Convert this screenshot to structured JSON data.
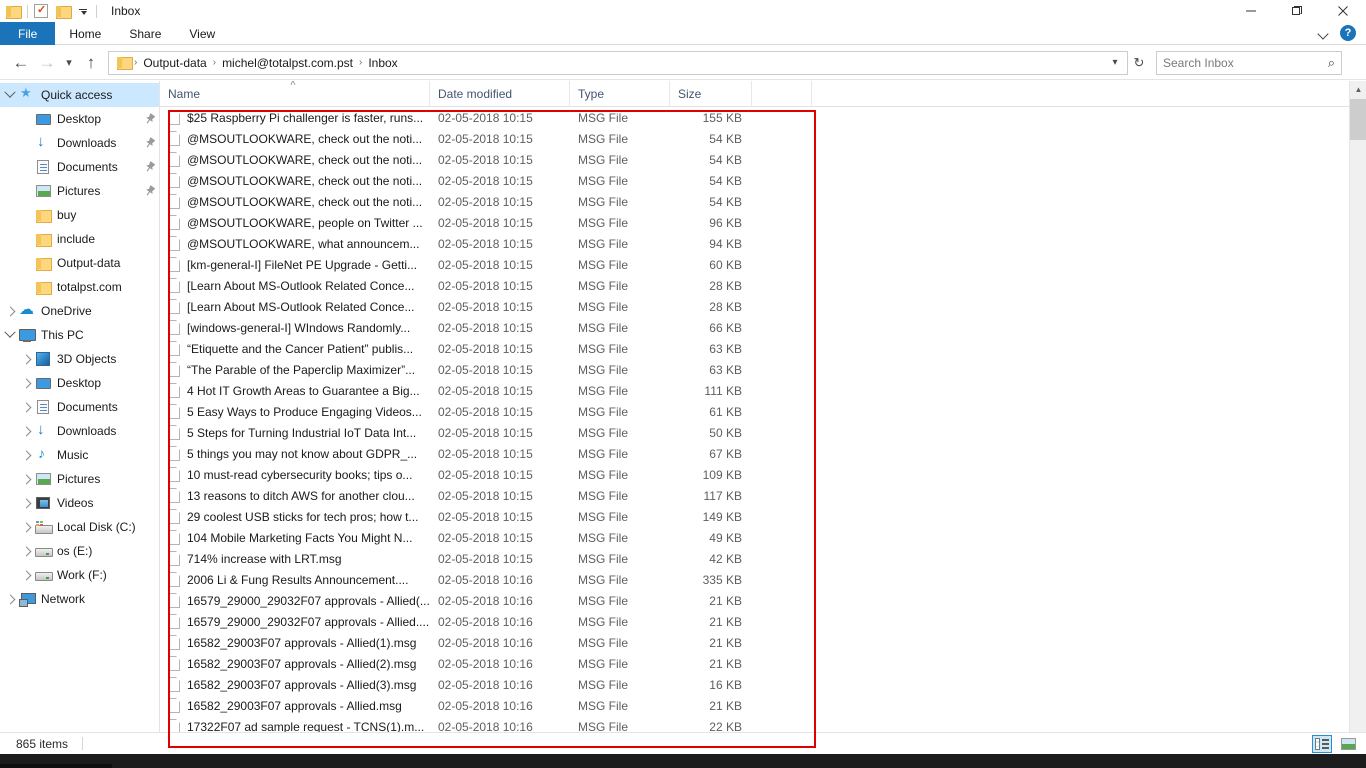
{
  "window": {
    "title": "Inbox",
    "quick_access_icons": [
      "folder-icon",
      "properties-icon",
      "new-folder-icon",
      "customize-dropdown-icon"
    ],
    "controls": {
      "minimize": "minimize-icon",
      "maximize": "maximize-icon",
      "close": "close-icon"
    }
  },
  "ribbon": {
    "tabs": [
      {
        "label": "File",
        "active": true
      },
      {
        "label": "Home",
        "active": false
      },
      {
        "label": "Share",
        "active": false
      },
      {
        "label": "View",
        "active": false
      }
    ],
    "collapse_icon": "chevron-down-icon",
    "help_label": "?"
  },
  "address_bar": {
    "back_icon": "back-arrow-icon",
    "forward_icon": "forward-arrow-icon",
    "recent_icon": "recent-locations-chevron-icon",
    "up_icon": "up-arrow-icon",
    "breadcrumb": [
      "Output-data",
      "michel@totalpst.com.pst",
      "Inbox"
    ],
    "separator": "›",
    "refresh_icon": "refresh-icon",
    "dropdown_icon": "chevron-down-icon"
  },
  "search": {
    "placeholder": "Search Inbox",
    "value": "",
    "icon": "search-icon"
  },
  "sidebar": {
    "items": [
      {
        "label": "Quick access",
        "indent": 0,
        "expander": "open",
        "icon": "quick-access-star-icon",
        "selected": true,
        "pinned": false
      },
      {
        "label": "Desktop",
        "indent": 1,
        "expander": "none",
        "icon": "desktop-icon",
        "selected": false,
        "pinned": true
      },
      {
        "label": "Downloads",
        "indent": 1,
        "expander": "none",
        "icon": "downloads-icon",
        "selected": false,
        "pinned": true
      },
      {
        "label": "Documents",
        "indent": 1,
        "expander": "none",
        "icon": "documents-icon",
        "selected": false,
        "pinned": true
      },
      {
        "label": "Pictures",
        "indent": 1,
        "expander": "none",
        "icon": "pictures-icon",
        "selected": false,
        "pinned": true
      },
      {
        "label": "buy",
        "indent": 1,
        "expander": "none",
        "icon": "folder-icon",
        "selected": false,
        "pinned": false
      },
      {
        "label": "include",
        "indent": 1,
        "expander": "none",
        "icon": "folder-icon",
        "selected": false,
        "pinned": false
      },
      {
        "label": "Output-data",
        "indent": 1,
        "expander": "none",
        "icon": "folder-icon",
        "selected": false,
        "pinned": false
      },
      {
        "label": "totalpst.com",
        "indent": 1,
        "expander": "none",
        "icon": "folder-icon",
        "selected": false,
        "pinned": false
      },
      {
        "label": "OneDrive",
        "indent": 0,
        "expander": "closed",
        "icon": "onedrive-cloud-icon",
        "selected": false,
        "pinned": false
      },
      {
        "label": "This PC",
        "indent": 0,
        "expander": "open",
        "icon": "this-pc-icon",
        "selected": false,
        "pinned": false
      },
      {
        "label": "3D Objects",
        "indent": 1,
        "expander": "closed",
        "icon": "3d-objects-icon",
        "selected": false,
        "pinned": false
      },
      {
        "label": "Desktop",
        "indent": 1,
        "expander": "closed",
        "icon": "desktop-icon",
        "selected": false,
        "pinned": false
      },
      {
        "label": "Documents",
        "indent": 1,
        "expander": "closed",
        "icon": "documents-icon",
        "selected": false,
        "pinned": false
      },
      {
        "label": "Downloads",
        "indent": 1,
        "expander": "closed",
        "icon": "downloads-icon",
        "selected": false,
        "pinned": false
      },
      {
        "label": "Music",
        "indent": 1,
        "expander": "closed",
        "icon": "music-icon",
        "selected": false,
        "pinned": false
      },
      {
        "label": "Pictures",
        "indent": 1,
        "expander": "closed",
        "icon": "pictures-icon",
        "selected": false,
        "pinned": false
      },
      {
        "label": "Videos",
        "indent": 1,
        "expander": "closed",
        "icon": "videos-icon",
        "selected": false,
        "pinned": false
      },
      {
        "label": "Local Disk (C:)",
        "indent": 1,
        "expander": "closed",
        "icon": "local-disk-icon",
        "selected": false,
        "pinned": false
      },
      {
        "label": "os (E:)",
        "indent": 1,
        "expander": "closed",
        "icon": "drive-icon",
        "selected": false,
        "pinned": false
      },
      {
        "label": "Work (F:)",
        "indent": 1,
        "expander": "closed",
        "icon": "drive-icon",
        "selected": false,
        "pinned": false
      },
      {
        "label": "Network",
        "indent": 0,
        "expander": "closed",
        "icon": "network-icon",
        "selected": false,
        "pinned": false
      }
    ]
  },
  "file_list": {
    "columns": [
      {
        "label": "Name",
        "sorted": "asc"
      },
      {
        "label": "Date modified",
        "sorted": ""
      },
      {
        "label": "Type",
        "sorted": ""
      },
      {
        "label": "Size",
        "sorted": ""
      }
    ],
    "sort_indicator": "˄",
    "rows": [
      {
        "name": "$25 Raspberry Pi challenger is faster, runs...",
        "date": "02-05-2018 10:15",
        "type": "MSG File",
        "size": "155 KB"
      },
      {
        "name": "@MSOUTLOOKWARE, check out the noti...",
        "date": "02-05-2018 10:15",
        "type": "MSG File",
        "size": "54 KB"
      },
      {
        "name": "@MSOUTLOOKWARE, check out the noti...",
        "date": "02-05-2018 10:15",
        "type": "MSG File",
        "size": "54 KB"
      },
      {
        "name": "@MSOUTLOOKWARE, check out the noti...",
        "date": "02-05-2018 10:15",
        "type": "MSG File",
        "size": "54 KB"
      },
      {
        "name": "@MSOUTLOOKWARE, check out the noti...",
        "date": "02-05-2018 10:15",
        "type": "MSG File",
        "size": "54 KB"
      },
      {
        "name": "@MSOUTLOOKWARE, people on Twitter ...",
        "date": "02-05-2018 10:15",
        "type": "MSG File",
        "size": "96 KB"
      },
      {
        "name": "@MSOUTLOOKWARE, what announcem...",
        "date": "02-05-2018 10:15",
        "type": "MSG File",
        "size": "94 KB"
      },
      {
        "name": "[km-general-I] FileNet PE Upgrade - Getti...",
        "date": "02-05-2018 10:15",
        "type": "MSG File",
        "size": "60 KB"
      },
      {
        "name": "[Learn About MS-Outlook Related Conce...",
        "date": "02-05-2018 10:15",
        "type": "MSG File",
        "size": "28 KB"
      },
      {
        "name": "[Learn About MS-Outlook Related Conce...",
        "date": "02-05-2018 10:15",
        "type": "MSG File",
        "size": "28 KB"
      },
      {
        "name": "[windows-general-I] WIndows Randomly...",
        "date": "02-05-2018 10:15",
        "type": "MSG File",
        "size": "66 KB"
      },
      {
        "name": "“Etiquette and the Cancer Patient” publis...",
        "date": "02-05-2018 10:15",
        "type": "MSG File",
        "size": "63 KB"
      },
      {
        "name": "“The Parable of the Paperclip Maximizer”...",
        "date": "02-05-2018 10:15",
        "type": "MSG File",
        "size": "63 KB"
      },
      {
        "name": "4 Hot IT Growth Areas to Guarantee a Big...",
        "date": "02-05-2018 10:15",
        "type": "MSG File",
        "size": "111 KB"
      },
      {
        "name": "5 Easy Ways to Produce Engaging Videos...",
        "date": "02-05-2018 10:15",
        "type": "MSG File",
        "size": "61 KB"
      },
      {
        "name": "5 Steps for Turning Industrial IoT Data Int...",
        "date": "02-05-2018 10:15",
        "type": "MSG File",
        "size": "50 KB"
      },
      {
        "name": "5 things you may not know about GDPR_...",
        "date": "02-05-2018 10:15",
        "type": "MSG File",
        "size": "67 KB"
      },
      {
        "name": "10 must-read cybersecurity books; tips o...",
        "date": "02-05-2018 10:15",
        "type": "MSG File",
        "size": "109 KB"
      },
      {
        "name": "13 reasons to ditch AWS for another clou...",
        "date": "02-05-2018 10:15",
        "type": "MSG File",
        "size": "117 KB"
      },
      {
        "name": "29 coolest USB sticks for tech pros; how t...",
        "date": "02-05-2018 10:15",
        "type": "MSG File",
        "size": "149 KB"
      },
      {
        "name": "104 Mobile Marketing Facts You Might N...",
        "date": "02-05-2018 10:15",
        "type": "MSG File",
        "size": "49 KB"
      },
      {
        "name": "714% increase with LRT.msg",
        "date": "02-05-2018 10:15",
        "type": "MSG File",
        "size": "42 KB"
      },
      {
        "name": "2006 Li & Fung Results Announcement....",
        "date": "02-05-2018 10:16",
        "type": "MSG File",
        "size": "335 KB"
      },
      {
        "name": "16579_29000_29032F07 approvals - Allied(...",
        "date": "02-05-2018 10:16",
        "type": "MSG File",
        "size": "21 KB"
      },
      {
        "name": "16579_29000_29032F07 approvals - Allied....",
        "date": "02-05-2018 10:16",
        "type": "MSG File",
        "size": "21 KB"
      },
      {
        "name": "16582_29003F07 approvals - Allied(1).msg",
        "date": "02-05-2018 10:16",
        "type": "MSG File",
        "size": "21 KB"
      },
      {
        "name": "16582_29003F07 approvals - Allied(2).msg",
        "date": "02-05-2018 10:16",
        "type": "MSG File",
        "size": "21 KB"
      },
      {
        "name": "16582_29003F07 approvals - Allied(3).msg",
        "date": "02-05-2018 10:16",
        "type": "MSG File",
        "size": "16 KB"
      },
      {
        "name": "16582_29003F07 approvals - Allied.msg",
        "date": "02-05-2018 10:16",
        "type": "MSG File",
        "size": "21 KB"
      },
      {
        "name": "17322F07 ad sample request - TCNS(1).m...",
        "date": "02-05-2018 10:16",
        "type": "MSG File",
        "size": "22 KB"
      }
    ]
  },
  "status_bar": {
    "item_count": "865 items",
    "view_buttons": [
      {
        "name": "details-view-button",
        "icon": "details-view-icon",
        "active": true
      },
      {
        "name": "large-icons-view-button",
        "icon": "large-icons-view-icon",
        "active": false
      }
    ]
  },
  "annotation": {
    "color": "#e10000",
    "shape": "rectangle"
  },
  "scrollbar": {
    "up_icon": "scroll-up-icon",
    "down_icon": "scroll-down-icon"
  }
}
